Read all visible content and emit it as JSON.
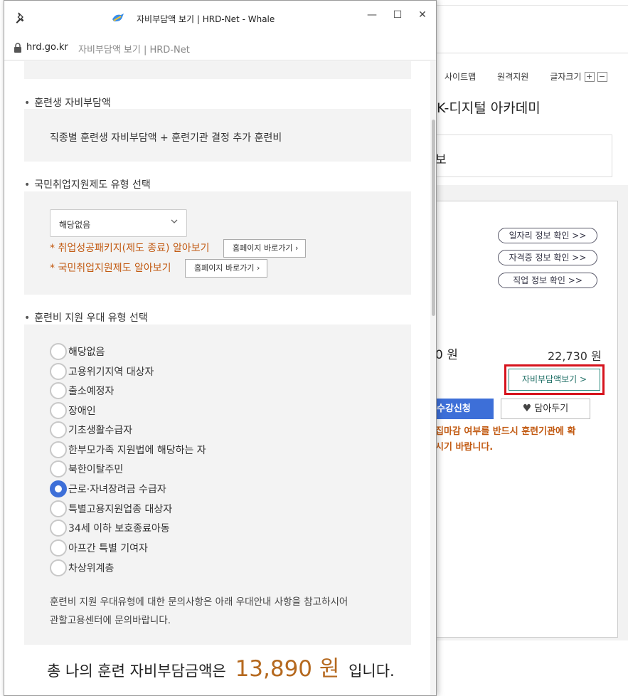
{
  "background": {
    "util_menu": [
      "사이트맵",
      "원격지원",
      "글자크기"
    ],
    "font_plus": "+",
    "font_minus": "−",
    "academy_title": "K-디지털 아카데미",
    "info_label": "보",
    "info_links": [
      "일자리 정보 확인 >>",
      "자격증 정보 확인 >>",
      "직업 정보 확인 >>"
    ],
    "price_left": "0 원",
    "price_right": "22,730 원",
    "selfpay_button": "자비부담액보기 >",
    "apply_button": "수강신청",
    "wish_button": "담아두기",
    "notice_lines": [
      "집마감 여부를 반드시 훈련기관에 확",
      "시기 바랍니다."
    ]
  },
  "window": {
    "title": "자비부담액 보기 | HRD-Net - Whale",
    "address_host": "hrd.go.kr",
    "address_title": "자비부담액 보기 | HRD-Net"
  },
  "sections": {
    "trainee_cost_title": "훈련생 자비부담액",
    "trainee_cost_desc": "직종별 훈련생 자비부담액 + 훈련기관 결정 추가 훈련비",
    "employment_title": "국민취업지원제도 유형 선택",
    "employment_select_value": "해당없음",
    "link1_text": "* 취업성공패키지(제도 종료) 알아보기",
    "link2_text": "* 국민취업지원제도 알아보기",
    "home_button": "홈페이지 바로가기",
    "support_title": "훈련비 지원 우대 유형 선택",
    "radio_options": [
      "해당없음",
      "고용위기지역 대상자",
      "출소예정자",
      "장애인",
      "기초생활수급자",
      "한부모가족 지원법에 해당하는 자",
      "북한이탈주민",
      "근로·자녀장려금 수급자",
      "특별고용지원업종 대상자",
      "34세 이하 보호종료아동",
      "아프간 특별 기여자",
      "차상위계층"
    ],
    "selected_option": "근로·자녀장려금 수급자",
    "inquiry_line1": "훈련비 지원 우대유형에 대한 문의사항은 아래 우대안내 사항을 참고하시어",
    "inquiry_line2": "관할고용센터에 문의바랍니다.",
    "total_prefix": "총 나의 훈련 자비부담금액은",
    "total_amount": "13,890 원",
    "total_suffix": "입니다."
  },
  "colors": {
    "accent_blue": "#3d6fd8",
    "orange_text": "#c25a12",
    "amount_color": "#b5691f",
    "highlight_red": "#d6131d"
  }
}
